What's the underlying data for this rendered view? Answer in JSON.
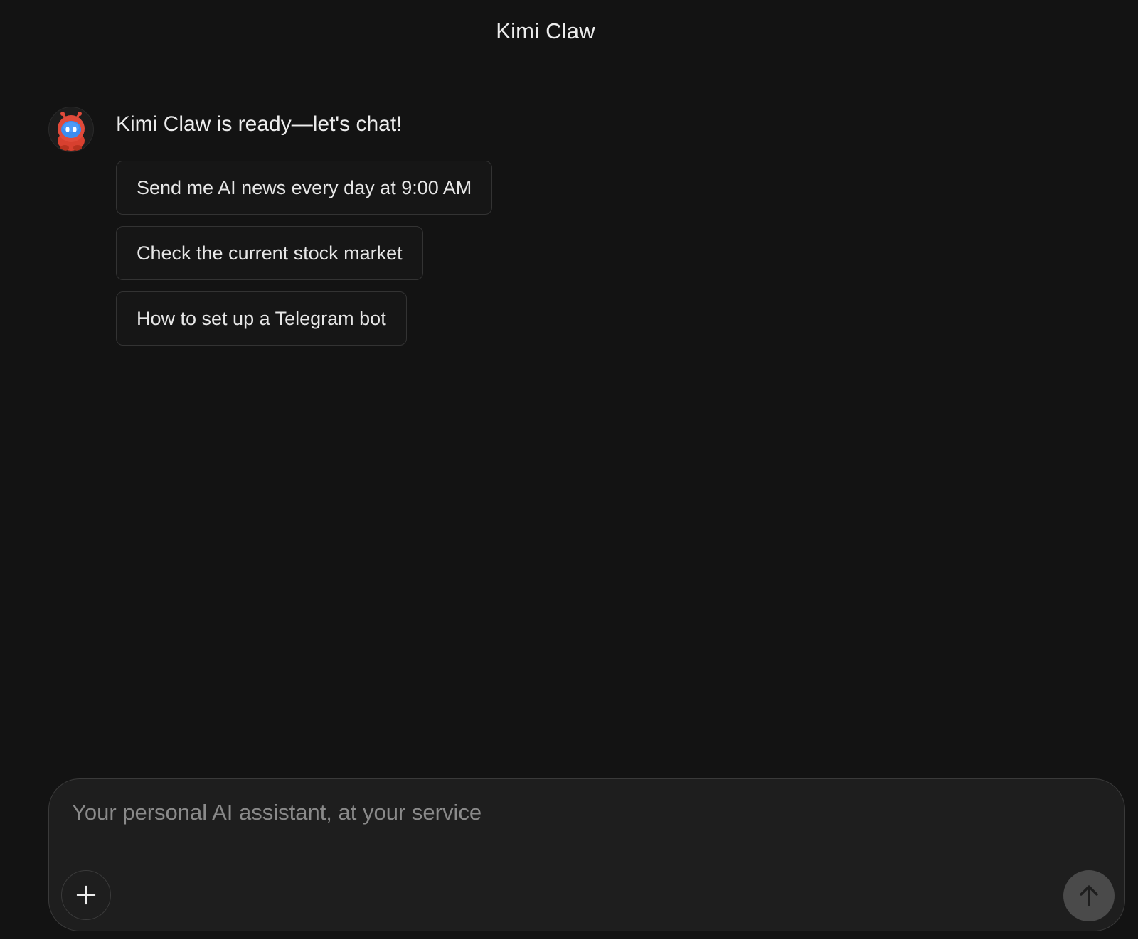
{
  "header": {
    "title": "Kimi Claw"
  },
  "message": {
    "avatar_icon": "robot-mascot-icon",
    "greeting": "Kimi Claw is ready—let's chat!",
    "suggestions": [
      {
        "label": "Send me AI news every day at 9:00 AM"
      },
      {
        "label": "Check the current stock market"
      },
      {
        "label": "How to set up a Telegram bot"
      }
    ]
  },
  "composer": {
    "placeholder": "Your personal AI assistant, at your service",
    "value": "",
    "add_icon": "plus-icon",
    "send_icon": "arrow-up-icon"
  },
  "colors": {
    "background": "#131313",
    "composer_bg": "#1e1e1e",
    "send_button": "#4a4a4a",
    "avatar_body": "#e04a3a",
    "avatar_face": "#3b8cf0"
  }
}
